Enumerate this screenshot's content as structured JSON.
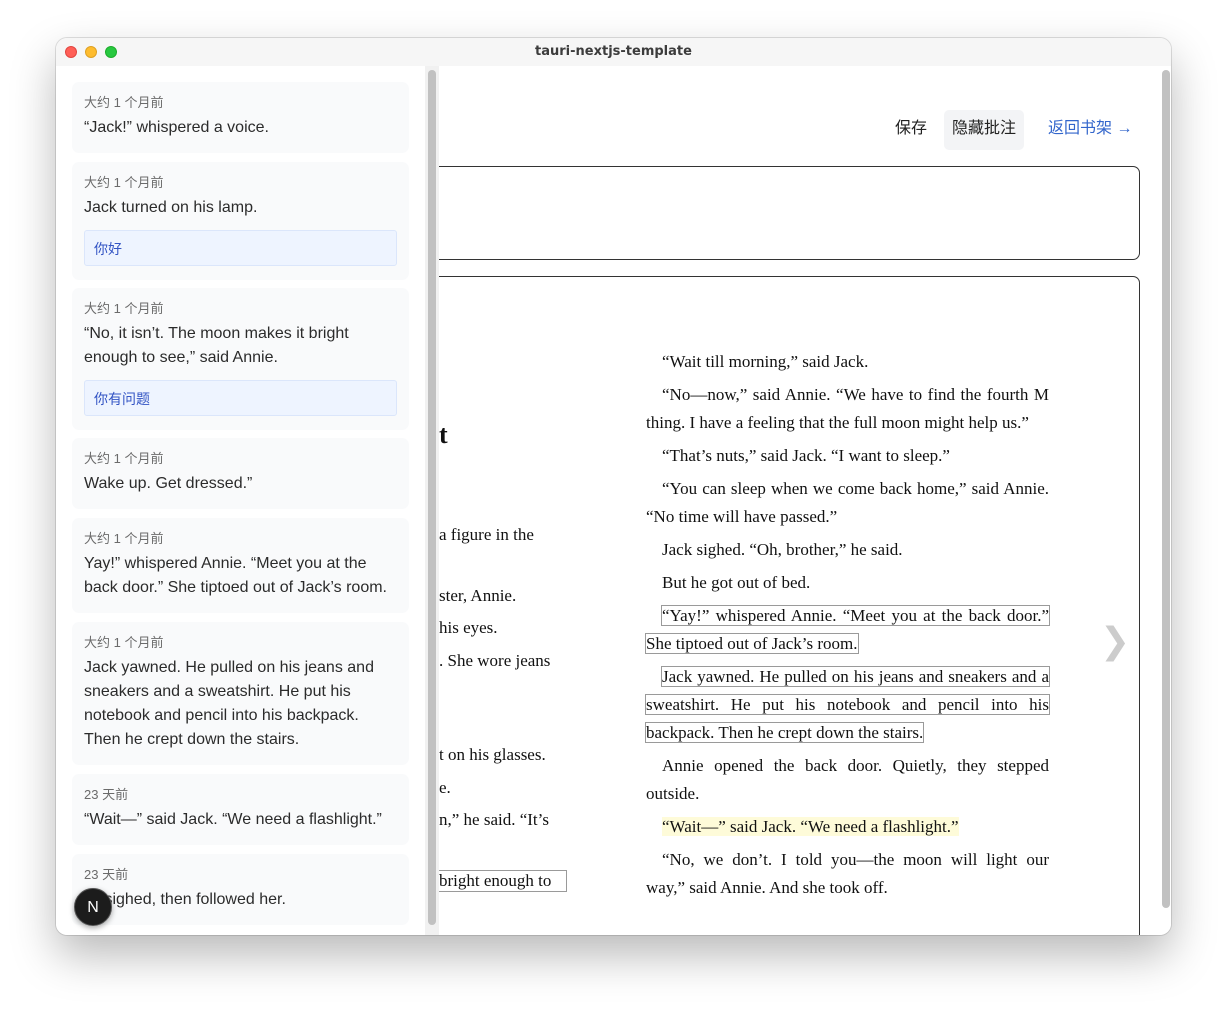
{
  "window": {
    "title": "tauri-nextjs-template"
  },
  "sidebar": {
    "cards": [
      {
        "time": "大约 1 个月前",
        "quote": "“Jack!” whispered a voice.",
        "note": ""
      },
      {
        "time": "大约 1 个月前",
        "quote": "Jack turned on his lamp.",
        "note": "你好"
      },
      {
        "time": "大约 1 个月前",
        "quote": "“No, it isn’t. The moon makes it bright enough to see,” said Annie.",
        "note": "你有问题"
      },
      {
        "time": "大约 1 个月前",
        "quote": "Wake up. Get dressed.”",
        "note": ""
      },
      {
        "time": "大约 1 个月前",
        "quote": "Yay!” whispered Annie. “Meet you at the back door.” She tiptoed out of Jack’s room.",
        "note": ""
      },
      {
        "time": "大约 1 个月前",
        "quote": "Jack yawned. He pulled on his jeans and sneakers and a sweatshirt. He put his notebook and pencil into his backpack. Then he crept down the stairs.",
        "note": ""
      },
      {
        "time": "23 天前",
        "quote": "“Wait—” said Jack. “We need a flashlight.”",
        "note": ""
      },
      {
        "time": "23 天前",
        "quote": "ck sighed, then followed her.",
        "note": ""
      }
    ],
    "fab_label": "N"
  },
  "toolbar": {
    "save_label": "保存",
    "hide_annotations_label": "隐藏批注",
    "back_to_shelf_label": "返回书架 →"
  },
  "book": {
    "left_fragments": [
      "t",
      "a  figure  in  the",
      "ster, Annie.",
      "his eyes.",
      ". She wore jeans",
      "t on his glasses.",
      "e.",
      "n,” he said. “It’s",
      "bright enough to"
    ],
    "right_paragraphs": [
      {
        "text": "“Wait till morning,” said Jack."
      },
      {
        "text": "“No—now,” said Annie. “We have to find the fourth M thing. I have a feeling that the full moon might help us.”"
      },
      {
        "text": "“That’s nuts,” said Jack. “I want to sleep.”"
      },
      {
        "text": "“You can sleep when we come back home,” said Annie. “No time will have passed.”"
      },
      {
        "text": "Jack sighed. “Oh, brother,” he said."
      },
      {
        "text": "But he got out of bed."
      },
      {
        "text": "“Yay!” whispered Annie. “Meet you at the back door.” She tiptoed out of Jack’s room."
      },
      {
        "text": "Jack yawned. He pulled on his jeans and sneakers and a sweatshirt. He put his notebook and pencil into his backpack. Then he crept down the stairs."
      },
      {
        "text": "Annie opened the back door. Quietly, they stepped outside."
      },
      {
        "text": "“Wait—” said Jack. “We need a flashlight.”"
      },
      {
        "text": "“No, we don’t. I told you—the moon will light our way,” said Annie. And she took off."
      }
    ],
    "next_page_glyph": "❯"
  }
}
